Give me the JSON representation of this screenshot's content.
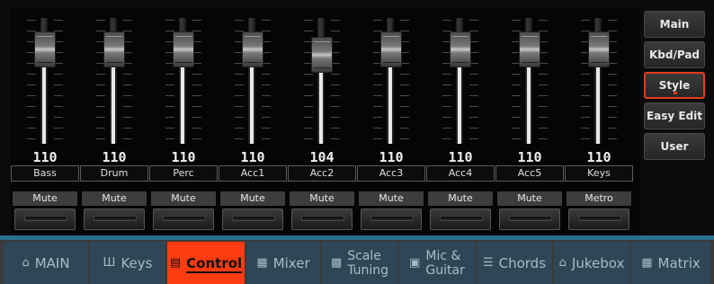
{
  "mixer": {
    "channels": [
      {
        "name": "Bass",
        "value": "110",
        "mute": "Mute",
        "level": 0.85
      },
      {
        "name": "Drum",
        "value": "110",
        "mute": "Mute",
        "level": 0.85
      },
      {
        "name": "Perc",
        "value": "110",
        "mute": "Mute",
        "level": 0.85
      },
      {
        "name": "Acc1",
        "value": "110",
        "mute": "Mute",
        "level": 0.85
      },
      {
        "name": "Acc2",
        "value": "104",
        "mute": "Mute",
        "level": 0.79
      },
      {
        "name": "Acc3",
        "value": "110",
        "mute": "Mute",
        "level": 0.85
      },
      {
        "name": "Acc4",
        "value": "110",
        "mute": "Mute",
        "level": 0.85
      },
      {
        "name": "Acc5",
        "value": "110",
        "mute": "Mute",
        "level": 0.85
      },
      {
        "name": "Keys",
        "value": "110",
        "mute": "Metro",
        "level": 0.85
      }
    ]
  },
  "side_buttons": [
    {
      "label": "Main",
      "active": false
    },
    {
      "label": "Kbd/Pad",
      "active": false
    },
    {
      "label": "Style",
      "active": true
    },
    {
      "label": "Easy Edit",
      "active": false
    },
    {
      "label": "User",
      "active": false
    }
  ],
  "tabs": [
    {
      "label": "MAIN",
      "icon": "home-icon",
      "glyph": "⌂",
      "active": false
    },
    {
      "label": "Keys",
      "icon": "keys-icon",
      "glyph": "Ш",
      "active": false
    },
    {
      "label": "Control",
      "icon": "control-icon",
      "glyph": "▤",
      "active": true
    },
    {
      "label": "Mixer",
      "icon": "mixer-icon",
      "glyph": "▦",
      "active": false
    },
    {
      "label": "Scale",
      "label2": "Tuning",
      "icon": "scale-icon",
      "glyph": "▩",
      "active": false
    },
    {
      "label": "Mic &",
      "label2": "Guitar",
      "icon": "mic-icon",
      "glyph": "▣",
      "active": false
    },
    {
      "label": "Chords",
      "icon": "chords-icon",
      "glyph": "☰",
      "active": false
    },
    {
      "label": "Jukebox",
      "icon": "jukebox-icon",
      "glyph": "⌂",
      "active": false
    },
    {
      "label": "Matrix",
      "icon": "matrix-icon",
      "glyph": "▦",
      "active": false
    }
  ],
  "colors": {
    "accent": "#ff3b12",
    "tab_bg": "#2d4757",
    "tab_text": "#a9bcc6"
  }
}
